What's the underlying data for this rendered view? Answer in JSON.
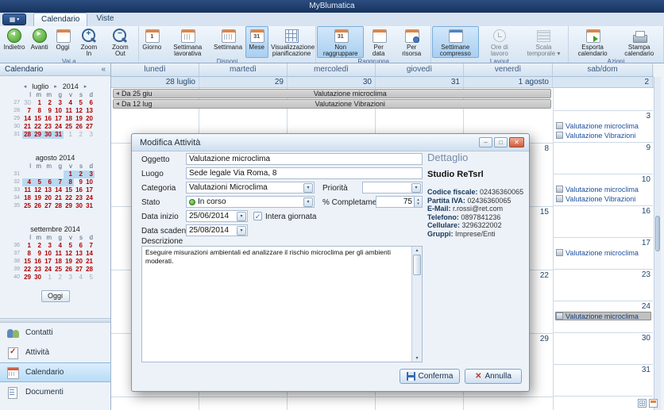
{
  "window": {
    "title": "MyBlumatica"
  },
  "icons": {
    "app_menu": "▦",
    "down": "▾",
    "up": "▴",
    "prev": "◂",
    "next": "▸",
    "collapse": "«",
    "check": "✓",
    "continues": "◂",
    "minimize": "–",
    "maximize": "□",
    "close": "✕"
  },
  "tabs": {
    "items": [
      {
        "label": "Calendario",
        "active": true
      },
      {
        "label": "Viste",
        "active": false
      }
    ]
  },
  "ribbon": {
    "groups": [
      {
        "label": "Vai a",
        "buttons": [
          {
            "label": "Indietro",
            "icon": "back"
          },
          {
            "label": "Avanti",
            "icon": "forward"
          },
          {
            "label": "Oggi",
            "icon": "today"
          },
          {
            "label": "Zoom In",
            "icon": "zoom-in"
          },
          {
            "label": "Zoom Out",
            "icon": "zoom-out"
          }
        ]
      },
      {
        "label": "Disponi",
        "buttons": [
          {
            "label": "Giorno",
            "icon": "cal-day"
          },
          {
            "label": "Settimana lavorativa",
            "icon": "cal-workweek"
          },
          {
            "label": "Settimana",
            "icon": "cal-week"
          },
          {
            "label": "Mese",
            "icon": "cal-month",
            "selected": true
          },
          {
            "label": "Visualizzazione pianificazione",
            "icon": "grid"
          }
        ]
      },
      {
        "label": "Raggruppa",
        "buttons": [
          {
            "label": "Non raggruppare",
            "icon": "cal-month",
            "selected": true
          },
          {
            "label": "Per data",
            "icon": "cal-date"
          },
          {
            "label": "Per risorsa",
            "icon": "cal-resource"
          }
        ]
      },
      {
        "label": "Layout",
        "buttons": [
          {
            "label": "Settimane compresso",
            "icon": "cal-compress",
            "selected": true
          },
          {
            "label": "Ore di lavoro",
            "icon": "clock",
            "disabled": true
          },
          {
            "label": "Scala temporale",
            "icon": "scale",
            "disabled": true,
            "dropdown": true
          }
        ]
      },
      {
        "label": "Azioni",
        "buttons": [
          {
            "label": "Esporta calendario",
            "icon": "cal-export"
          },
          {
            "label": "Stampa calendario",
            "icon": "printer"
          }
        ]
      }
    ]
  },
  "sidebar": {
    "header": "Calendario",
    "today_button": "Oggi",
    "day_headers": [
      "l",
      "m",
      "m",
      "g",
      "v",
      "s",
      "d"
    ],
    "months": [
      {
        "name": "luglio",
        "year": "2014",
        "nav": true,
        "weeks": [
          {
            "num": "27",
            "days": [
              "30|m",
              "1|r",
              "2|r",
              "3|r",
              "4|r",
              "5|r",
              "6|r"
            ]
          },
          {
            "num": "28",
            "days": [
              "7|r",
              "8|r",
              "9|r",
              "10|r",
              "11|r",
              "12|r",
              "13|r"
            ]
          },
          {
            "num": "29",
            "days": [
              "14|r",
              "15|r",
              "16|r",
              "17|r",
              "18|r",
              "19|r",
              "20|r"
            ]
          },
          {
            "num": "30",
            "days": [
              "21|r",
              "22|r",
              "23|r",
              "24|r",
              "25|r",
              "26|r",
              "27|r"
            ]
          },
          {
            "num": "31",
            "days": [
              "28|s",
              "29|s",
              "30|s",
              "31|s",
              "1|m",
              "2|m",
              "3|m"
            ]
          }
        ]
      },
      {
        "name": "agosto",
        "year": "2014",
        "nav": false,
        "weeks": [
          {
            "num": "31",
            "days": [
              "|e",
              "|e",
              "|e",
              "|e",
              "1|s",
              "2|s",
              "3|s"
            ]
          },
          {
            "num": "32",
            "days": [
              "4|s",
              "5|s",
              "6|s",
              "7|s",
              "8|s",
              "9|r",
              "10|r"
            ]
          },
          {
            "num": "33",
            "days": [
              "11|r",
              "12|r",
              "13|r",
              "14|r",
              "15|r",
              "16|r",
              "17|r"
            ]
          },
          {
            "num": "34",
            "days": [
              "18|r",
              "19|r",
              "20|r",
              "21|r",
              "22|r",
              "23|r",
              "24|r"
            ]
          },
          {
            "num": "35",
            "days": [
              "25|r",
              "26|r",
              "27|r",
              "28|r",
              "29|r",
              "30|r",
              "31|r"
            ]
          }
        ]
      },
      {
        "name": "settembre",
        "year": "2014",
        "nav": false,
        "weeks": [
          {
            "num": "36",
            "days": [
              "1|r",
              "2|r",
              "3|r",
              "4|r",
              "5|r",
              "6|r",
              "7|r"
            ]
          },
          {
            "num": "37",
            "days": [
              "8|r",
              "9|r",
              "10|r",
              "11|r",
              "12|r",
              "13|r",
              "14|r"
            ]
          },
          {
            "num": "38",
            "days": [
              "15|r",
              "16|r",
              "17|r",
              "18|r",
              "19|r",
              "20|r",
              "21|r"
            ]
          },
          {
            "num": "39",
            "days": [
              "22|r",
              "23|r",
              "24|r",
              "25|r",
              "26|r",
              "27|r",
              "28|r"
            ]
          },
          {
            "num": "40",
            "days": [
              "29|r",
              "30|r",
              "1|m",
              "2|m",
              "3|m",
              "4|m",
              "5|m"
            ]
          }
        ]
      }
    ],
    "nav_items": [
      {
        "label": "Contatti",
        "icon": "contacts",
        "selected": false
      },
      {
        "label": "Attività",
        "icon": "tasks",
        "selected": false
      },
      {
        "label": "Calendario",
        "icon": "calendar",
        "selected": true
      },
      {
        "label": "Documenti",
        "icon": "documents",
        "selected": false
      }
    ]
  },
  "calendar": {
    "column_headers": [
      "lunedì",
      "martedì",
      "mercoledì",
      "giovedì",
      "venerdì",
      "sab/dom"
    ],
    "date_row": [
      "28 luglio",
      "29",
      "30",
      "31",
      "1 agosto",
      "2"
    ],
    "banners": [
      {
        "prefix": "Da 25 giu",
        "title": "Valutazione microclima"
      },
      {
        "prefix": "Da 12 lug",
        "title": "Valutazione Vibrazioni"
      }
    ],
    "friday_numbers": [
      "8",
      "15",
      "22",
      "29"
    ],
    "weekend_cells": [
      {
        "day": "",
        "events": []
      },
      {
        "day": "3",
        "events": [
          {
            "title": "Valutazione microclima"
          },
          {
            "title": "Valutazione Vibrazioni"
          }
        ]
      },
      {
        "day": "9",
        "events": []
      },
      {
        "day": "10",
        "events": [
          {
            "title": "Valutazione microclima"
          },
          {
            "title": "Valutazione Vibrazioni"
          }
        ]
      },
      {
        "day": "16",
        "events": []
      },
      {
        "day": "17",
        "events": [
          {
            "title": "Valutazione microclima"
          }
        ]
      },
      {
        "day": "23",
        "events": []
      },
      {
        "day": "24",
        "events": [
          {
            "title": "Valutazione microclima",
            "selected": true
          }
        ]
      },
      {
        "day": "30",
        "events": []
      },
      {
        "day": "31",
        "events": []
      },
      {
        "day": "",
        "events": []
      }
    ]
  },
  "statusbar": {
    "icons": [
      "table-view",
      "calendar-view"
    ]
  },
  "dialog": {
    "title": "Modifica Attività",
    "fields": {
      "oggetto": {
        "label": "Oggetto",
        "value": "Valutazione microclima"
      },
      "luogo": {
        "label": "Luogo",
        "value": "Sede legale Via Roma, 8"
      },
      "categoria": {
        "label": "Categoria",
        "value": "Valutazioni Microclima"
      },
      "priorita": {
        "label": "Priorità",
        "value": ""
      },
      "stato": {
        "label": "Stato",
        "value": "In corso"
      },
      "completamento": {
        "label": "% Completamento",
        "value": "75"
      },
      "data_inizio": {
        "label": "Data inizio",
        "value": "25/06/2014"
      },
      "intera_giornata": {
        "label": "Intera giornata",
        "checked": true
      },
      "data_scadenza": {
        "label": "Data scadenza",
        "value": "25/08/2014"
      },
      "descrizione": {
        "label": "Descrizione",
        "value": "Eseguire misurazioni ambientali ed analizzare il rischio microclima per gli ambienti moderati."
      }
    },
    "detail": {
      "heading": "Dettaglio",
      "company": "Studio ReTsrl",
      "rows": [
        {
          "label": "Codice fiscale:",
          "value": "02436360065"
        },
        {
          "label": "Partita IVA:",
          "value": "02436360065"
        },
        {
          "label": "E-Mail:",
          "value": "r.rossi@ret.com"
        },
        {
          "label": "Telefono:",
          "value": "0897841236"
        },
        {
          "label": "Cellulare:",
          "value": "3296322002"
        },
        {
          "label": "Gruppi:",
          "value": "Imprese/Enti"
        }
      ]
    },
    "buttons": {
      "confirm": "Conferma",
      "cancel": "Annulla"
    }
  }
}
